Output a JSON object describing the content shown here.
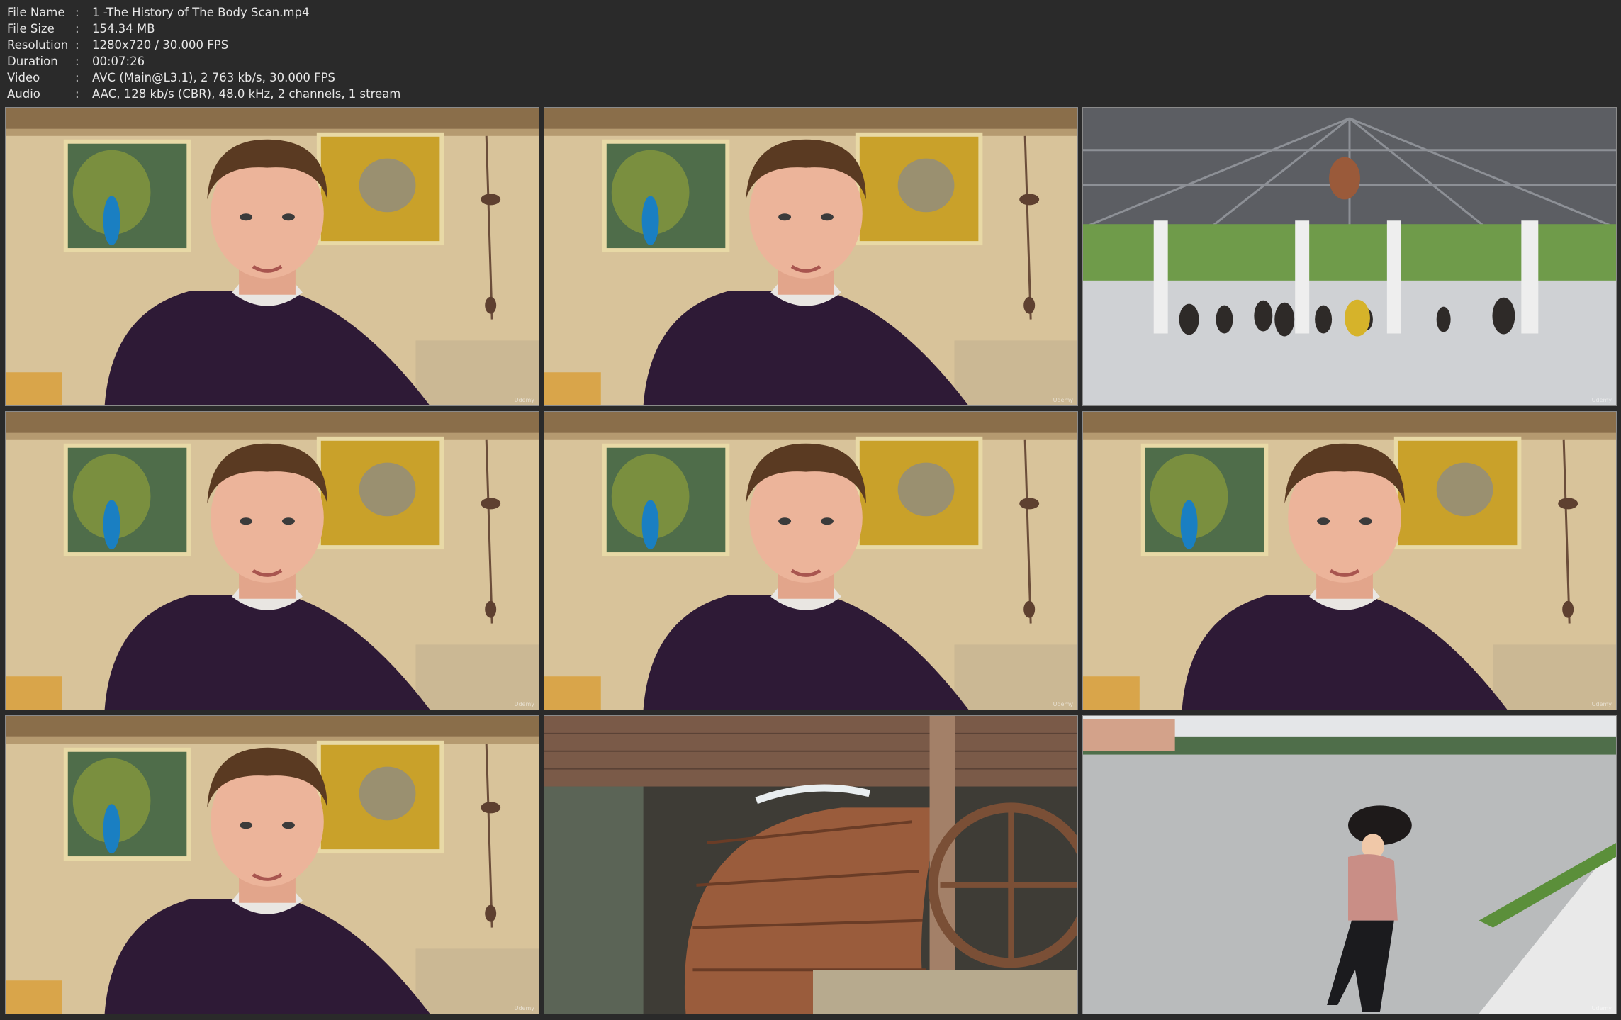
{
  "media_info": {
    "rows": [
      {
        "label": "File Name",
        "value": "1 -The History of The Body Scan.mp4"
      },
      {
        "label": "File Size",
        "value": "154.34 MB"
      },
      {
        "label": "Resolution",
        "value": "1280x720 / 30.000 FPS"
      },
      {
        "label": "Duration",
        "value": "00:07:26"
      },
      {
        "label": "Video",
        "value": "AVC (Main@L3.1), 2 763 kb/s, 30.000 FPS"
      },
      {
        "label": "Audio",
        "value": "AAC, 128 kb/s (CBR), 48.0 kHz, 2 channels, 1 stream"
      }
    ],
    "separator": ":"
  },
  "thumbnails": [
    {
      "scene": "presenter",
      "watermark": "Udemy"
    },
    {
      "scene": "presenter",
      "watermark": "Udemy"
    },
    {
      "scene": "yoga-pavilion",
      "watermark": "Udemy"
    },
    {
      "scene": "presenter",
      "watermark": "Udemy"
    },
    {
      "scene": "presenter",
      "watermark": "Udemy"
    },
    {
      "scene": "presenter",
      "watermark": "Udemy"
    },
    {
      "scene": "presenter",
      "watermark": "Udemy"
    },
    {
      "scene": "water-wheel",
      "watermark": ""
    },
    {
      "scene": "runner-by-lake",
      "watermark": "Udemy"
    }
  ],
  "colors": {
    "background": "#2a2a2a",
    "text": "#e6e6e6",
    "wall": "#d8c39a",
    "sweater": "#2e1a36"
  }
}
